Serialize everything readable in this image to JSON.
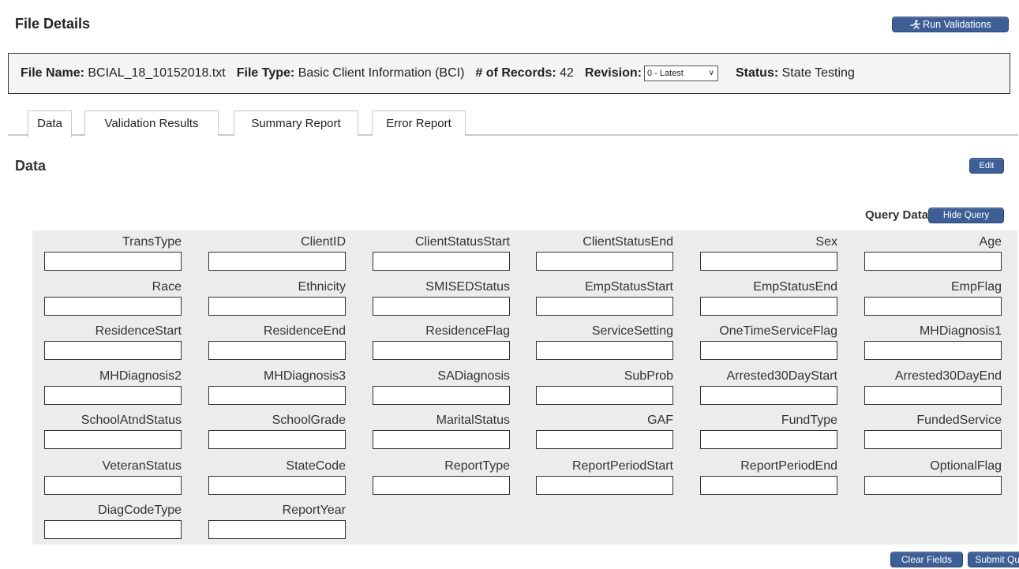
{
  "header": {
    "title": "File Details",
    "run_validations_label": "Run Validations"
  },
  "file_info": {
    "name_label": "File Name:",
    "name_value": "BCIAL_18_10152018.txt",
    "type_label": "File Type:",
    "type_value": "Basic Client Information (BCI)",
    "records_label": "# of Records:",
    "records_value": "42",
    "revision_label": "Revision:",
    "revision_value": "0 - Latest",
    "status_label": "Status:",
    "status_value": "State Testing"
  },
  "tabs": [
    {
      "label": "Data"
    },
    {
      "label": "Validation Results"
    },
    {
      "label": "Summary Report"
    },
    {
      "label": "Error Report"
    }
  ],
  "section": {
    "title": "Data",
    "edit_label": "Edit"
  },
  "query": {
    "label": "Query Data",
    "hide_label": "Hide Query",
    "clear_label": "Clear Fields",
    "submit_label": "Submit Query",
    "fields": [
      "TransType",
      "ClientID",
      "ClientStatusStart",
      "ClientStatusEnd",
      "Sex",
      "Age",
      "Race",
      "Ethnicity",
      "SMISEDStatus",
      "EmpStatusStart",
      "EmpStatusEnd",
      "EmpFlag",
      "ResidenceStart",
      "ResidenceEnd",
      "ResidenceFlag",
      "ServiceSetting",
      "OneTimeServiceFlag",
      "MHDiagnosis1",
      "MHDiagnosis2",
      "MHDiagnosis3",
      "SADiagnosis",
      "SubProb",
      "Arrested30DayStart",
      "Arrested30DayEnd",
      "SchoolAtndStatus",
      "SchoolGrade",
      "MaritalStatus",
      "GAF",
      "FundType",
      "FundedService",
      "VeteranStatus",
      "StateCode",
      "ReportType",
      "ReportPeriodStart",
      "ReportPeriodEnd",
      "OptionalFlag",
      "DiagCodeType",
      "ReportYear"
    ]
  },
  "colors": {
    "button_bg": "#3d5f96",
    "panel_bg": "#ececec",
    "info_bg": "#f4f4f4"
  }
}
